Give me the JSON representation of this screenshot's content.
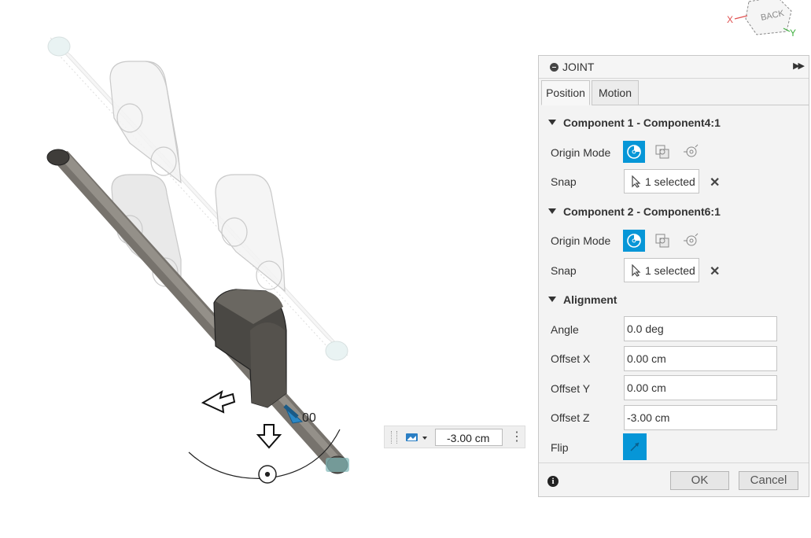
{
  "viewcube": {
    "face_label": "BACK",
    "axis_x": "X",
    "axis_y": "Y"
  },
  "canvas": {
    "dimension_label": "00"
  },
  "float_input": {
    "value": "-3.00 cm"
  },
  "panel": {
    "title": "JOINT",
    "tabs": [
      "Position",
      "Motion"
    ],
    "component1": {
      "header": "Component 1 - Component4:1",
      "origin_label": "Origin Mode",
      "snap_label": "Snap",
      "snap_value": "1 selected"
    },
    "component2": {
      "header": "Component 2 - Component6:1",
      "origin_label": "Origin Mode",
      "snap_label": "Snap",
      "snap_value": "1 selected"
    },
    "alignment": {
      "header": "Alignment",
      "angle_label": "Angle",
      "angle_value": "0.0 deg",
      "offset_x_label": "Offset X",
      "offset_x_value": "0.00 cm",
      "offset_y_label": "Offset Y",
      "offset_y_value": "0.00 cm",
      "offset_z_label": "Offset Z",
      "offset_z_value": "-3.00 cm",
      "flip_label": "Flip"
    },
    "ok_label": "OK",
    "cancel_label": "Cancel"
  },
  "colors": {
    "accent": "#0696d7",
    "panel_bg": "#f3f3f3",
    "axis_x": "#e05050",
    "axis_y": "#40b040"
  }
}
